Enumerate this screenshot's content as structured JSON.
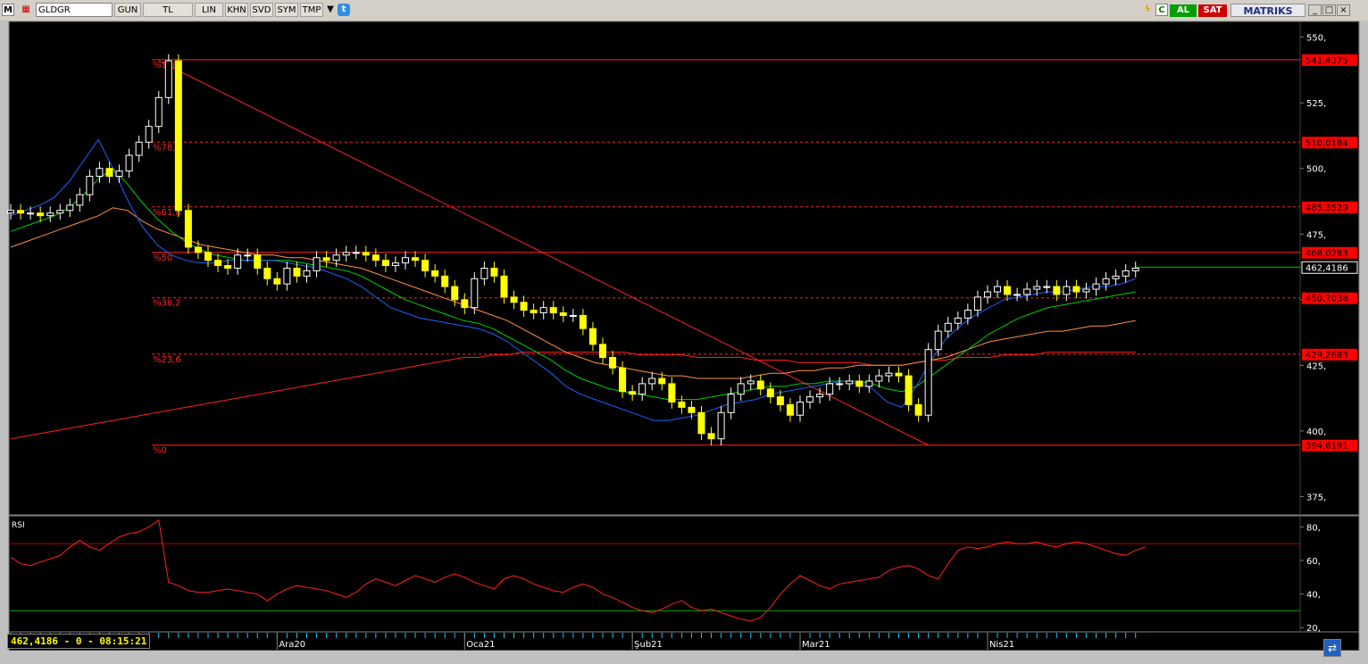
{
  "toolbar": {
    "m_label": "M",
    "symbol": "GLDGR",
    "period": "GUN",
    "currency": "TL",
    "scale": "LIN",
    "buttons": [
      "KHN",
      "SVD",
      "SYM",
      "TMP"
    ],
    "buy_label": "AL",
    "sell_label": "SAT",
    "brand": "MATRIKS"
  },
  "readout": "462,4186 - 0 - 08:15:21",
  "colors": {
    "background": "#000000",
    "candle_up": "#ffffff",
    "candle_down": "#ffff00",
    "fib": "#ff2020",
    "ma_short": "#2060ff",
    "ma_mid": "#00d000",
    "ma_long": "#ff9040",
    "ma_slow": "#ff2020",
    "rsi": "#ff2020",
    "axis_text": "#ffffff"
  },
  "chart_data": [
    {
      "type": "candlestick",
      "y_ticks": [
        "550,",
        "525,",
        "500,",
        "475,",
        "450,",
        "425,",
        "400,",
        "375,"
      ],
      "ylim": [
        368,
        556
      ],
      "fib_levels": [
        {
          "label": "%100",
          "value": 541.4375,
          "tag": "541,4375"
        },
        {
          "label": "%78,6",
          "value": 510.0184,
          "tag": "510,0184"
        },
        {
          "label": "%61,8",
          "value": 485.3529,
          "tag": "485,3529"
        },
        {
          "label": "%50",
          "value": 468.0283,
          "tag": "468,0283"
        },
        {
          "label": "%38,2",
          "value": 450.7038,
          "tag": "450,7038"
        },
        {
          "label": "%23,6",
          "value": 429.2683,
          "tag": "429,2683"
        },
        {
          "label": "%0",
          "value": 394.6191,
          "tag": "394,6191"
        }
      ],
      "last_price": {
        "value": 462.4186,
        "tag": "462,4186"
      },
      "x_labels": [
        {
          "label": "Ara20",
          "index": 27
        },
        {
          "label": "Oca21",
          "index": 46
        },
        {
          "label": "Şub21",
          "index": 63
        },
        {
          "label": "Mar21",
          "index": 80
        },
        {
          "label": "Nis21",
          "index": 99
        }
      ],
      "closes": [
        484,
        483,
        483,
        482,
        483,
        484,
        486,
        490,
        497,
        500,
        497,
        499,
        505,
        510,
        516,
        527,
        541,
        484,
        470,
        468,
        465,
        463,
        462,
        467,
        467,
        462,
        458,
        456,
        462,
        459,
        461,
        466,
        465,
        467,
        468,
        468,
        467,
        465,
        463,
        464,
        466,
        465,
        461,
        459,
        455,
        450,
        447,
        458,
        462,
        459,
        451,
        449,
        446,
        445,
        447,
        445,
        444,
        444,
        439,
        433,
        428,
        424,
        415,
        414,
        418,
        420,
        418,
        411,
        409,
        407,
        399,
        397,
        407,
        414,
        418,
        419,
        416,
        413,
        410,
        406,
        411,
        413,
        414,
        418,
        418,
        419,
        417,
        419,
        421,
        422,
        421,
        410,
        406,
        431,
        438,
        441,
        443,
        446,
        451,
        453,
        455,
        452,
        452,
        454,
        455,
        455,
        452,
        455,
        453,
        454,
        456,
        458,
        459,
        461,
        462
      ],
      "ma_short": [
        482,
        484,
        486,
        489,
        495,
        503,
        511,
        500,
        488,
        478,
        471,
        467,
        465,
        464,
        464,
        465,
        465,
        465,
        465,
        464,
        463,
        462,
        460,
        458,
        455,
        451,
        447,
        445,
        443,
        442,
        441,
        440,
        439,
        437,
        434,
        430,
        426,
        422,
        417,
        414,
        412,
        410,
        408,
        406,
        404,
        404,
        405,
        406,
        408,
        410,
        411,
        412,
        414,
        415,
        416,
        417,
        418,
        419,
        418,
        416,
        411,
        409,
        417,
        427,
        435,
        440,
        444,
        447,
        450,
        451,
        452,
        453,
        453,
        454,
        455,
        455,
        456,
        458
      ],
      "ma_mid": [
        476,
        478,
        480,
        482,
        485,
        490,
        496,
        500,
        494,
        487,
        481,
        476,
        472,
        469,
        467,
        466,
        465,
        465,
        465,
        465,
        464,
        463,
        462,
        461,
        459,
        456,
        453,
        450,
        448,
        446,
        444,
        442,
        441,
        439,
        436,
        433,
        430,
        427,
        423,
        420,
        418,
        416,
        415,
        414,
        413,
        412,
        412,
        412,
        413,
        414,
        415,
        416,
        417,
        417,
        418,
        418,
        419,
        419,
        419,
        418,
        416,
        415,
        417,
        421,
        425,
        429,
        433,
        437,
        440,
        443,
        445,
        447,
        448,
        449,
        450,
        451,
        452,
        453
      ],
      "ma_long": [
        470,
        472,
        474,
        476,
        478,
        480,
        482,
        485,
        484,
        480,
        477,
        475,
        473,
        471,
        470,
        469,
        468,
        467,
        467,
        466,
        466,
        465,
        464,
        463,
        462,
        460,
        458,
        456,
        454,
        452,
        450,
        448,
        446,
        444,
        442,
        439,
        436,
        433,
        430,
        428,
        426,
        425,
        424,
        423,
        422,
        421,
        421,
        420,
        420,
        420,
        420,
        421,
        422,
        422,
        423,
        423,
        424,
        424,
        425,
        425,
        425,
        425,
        426,
        427,
        428,
        430,
        432,
        434,
        435,
        436,
        437,
        438,
        438,
        439,
        440,
        440,
        441,
        442
      ],
      "ma_slow": [
        397,
        398,
        399,
        400,
        401,
        402,
        403,
        404,
        405,
        406,
        407,
        408,
        409,
        410,
        411,
        412,
        413,
        414,
        415,
        416,
        417,
        418,
        419,
        420,
        421,
        422,
        423,
        424,
        425,
        426,
        427,
        428,
        428,
        429,
        429,
        430,
        430,
        430,
        430,
        430,
        430,
        430,
        430,
        429,
        429,
        429,
        429,
        428,
        428,
        428,
        428,
        427,
        427,
        427,
        426,
        426,
        426,
        426,
        426,
        425,
        425,
        425,
        426,
        427,
        427,
        428,
        428,
        428,
        429,
        429,
        429,
        430,
        430,
        430,
        430,
        430,
        430,
        430
      ]
    },
    {
      "type": "line",
      "title": "RSI",
      "y_ticks": [
        "80,",
        "60,",
        "40,",
        "20,"
      ],
      "ylim": [
        18,
        86
      ],
      "levels": [
        70,
        30
      ],
      "values": [
        62,
        58,
        57,
        59,
        61,
        63,
        68,
        72,
        68,
        66,
        70,
        74,
        76,
        77,
        80,
        84,
        47,
        45,
        42,
        41,
        41,
        42,
        43,
        42,
        41,
        40,
        36,
        40,
        43,
        45,
        44,
        43,
        42,
        40,
        38,
        41,
        46,
        49,
        47,
        45,
        48,
        51,
        49,
        47,
        50,
        52,
        50,
        47,
        45,
        43,
        49,
        51,
        49,
        46,
        44,
        42,
        41,
        44,
        46,
        44,
        40,
        38,
        35,
        32,
        30,
        29,
        31,
        34,
        36,
        32,
        30,
        31,
        29,
        27,
        25,
        24,
        26,
        32,
        40,
        46,
        51,
        48,
        45,
        43,
        46,
        47,
        48,
        49,
        50,
        54,
        56,
        57,
        55,
        51,
        49,
        58,
        66,
        68,
        67,
        68,
        70,
        71,
        70,
        70,
        71,
        69,
        68,
        70,
        71,
        70,
        68,
        66,
        64,
        63,
        66,
        68
      ]
    }
  ]
}
